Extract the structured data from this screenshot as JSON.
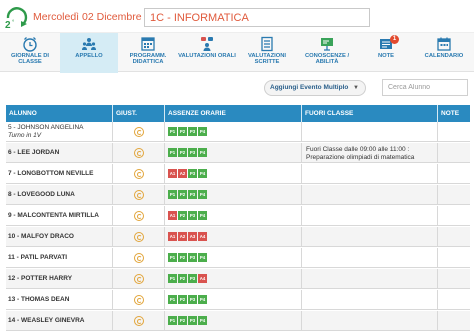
{
  "header": {
    "date": "Mercoledì 02 Dicembre",
    "class": "1C - INFORMATICA"
  },
  "colors": {
    "accent": "#e05a3c",
    "primary": "#2a7ab0",
    "table_header": "#2a8ac0",
    "present": "#4cae4c",
    "absent": "#d9534f",
    "giust": "#e2a53a"
  },
  "toolbar": [
    {
      "label": "GIORNALE DI CLASSE",
      "icon": "clock-icon",
      "active": false
    },
    {
      "label": "APPELLO",
      "icon": "people-icon",
      "active": true
    },
    {
      "label": "PROGRAMM. DIDATTICA",
      "icon": "calendar-grid-icon",
      "active": false
    },
    {
      "label": "VALUTAZIONI ORALI",
      "icon": "group-chat-icon",
      "active": false
    },
    {
      "label": "VALUTAZIONI SCRITTE",
      "icon": "checklist-icon",
      "active": false
    },
    {
      "label": "CONOSCENZE / ABILITÀ",
      "icon": "board-icon",
      "active": false
    },
    {
      "label": "NOTE",
      "icon": "notes-icon",
      "active": false,
      "badge": "1"
    },
    {
      "label": "CALENDARIO",
      "icon": "calendar-icon",
      "active": false
    }
  ],
  "actions": {
    "add_event": "Aggiungi Evento Multiplo",
    "search_placeholder": "Cerca Alunno"
  },
  "table": {
    "columns": [
      "ALUNNO",
      "GIUST.",
      "ASSENZE ORARIE",
      "FUORI CLASSE",
      "NOTE"
    ],
    "rows": [
      {
        "name": "5 - JOHNSON ANGELINA",
        "sub": "Turno in 1V",
        "hours": [
          "P1",
          "P2",
          "P3",
          "P4"
        ],
        "status": [
          "p",
          "p",
          "p",
          "p"
        ],
        "fuori": "",
        "absent": true
      },
      {
        "name": "6 - LEE JORDAN",
        "sub": "",
        "hours": [
          "P1",
          "P2",
          "P3",
          "P4"
        ],
        "status": [
          "p",
          "p",
          "p",
          "p"
        ],
        "fuori": "Fuori Classe dalle 09:00 alle 11:00 : Preparazione olimpiadi di matematica",
        "absent": false
      },
      {
        "name": "7 - LONGBOTTOM NEVILLE",
        "sub": "",
        "hours": [
          "A1",
          "A2",
          "P3",
          "P4"
        ],
        "status": [
          "a",
          "a",
          "p",
          "p"
        ],
        "fuori": "",
        "absent": false
      },
      {
        "name": "8 - LOVEGOOD LUNA",
        "sub": "",
        "hours": [
          "P1",
          "P2",
          "P3",
          "P4"
        ],
        "status": [
          "p",
          "p",
          "p",
          "p"
        ],
        "fuori": "",
        "absent": false
      },
      {
        "name": "9 - MALCONTENTA MIRTILLA",
        "sub": "",
        "hours": [
          "A1",
          "P2",
          "P3",
          "P4"
        ],
        "status": [
          "a",
          "p",
          "p",
          "p"
        ],
        "fuori": "",
        "absent": false
      },
      {
        "name": "10 - MALFOY DRACO",
        "sub": "",
        "hours": [
          "A1",
          "A2",
          "A3",
          "A4"
        ],
        "status": [
          "a",
          "a",
          "a",
          "a"
        ],
        "fuori": "",
        "absent": false
      },
      {
        "name": "11 - PATIL PARVATI",
        "sub": "",
        "hours": [
          "P1",
          "P2",
          "P3",
          "P4"
        ],
        "status": [
          "p",
          "p",
          "p",
          "p"
        ],
        "fuori": "",
        "absent": false
      },
      {
        "name": "12 - POTTER HARRY",
        "sub": "",
        "hours": [
          "P1",
          "P2",
          "P3",
          "A4"
        ],
        "status": [
          "p",
          "p",
          "p",
          "a"
        ],
        "fuori": "",
        "absent": false
      },
      {
        "name": "13 - THOMAS DEAN",
        "sub": "",
        "hours": [
          "P1",
          "P2",
          "P3",
          "P4"
        ],
        "status": [
          "p",
          "p",
          "p",
          "p"
        ],
        "fuori": "",
        "absent": false
      },
      {
        "name": "14 - WEASLEY GINEVRA",
        "sub": "",
        "hours": [
          "P1",
          "P2",
          "P3",
          "P4"
        ],
        "status": [
          "p",
          "p",
          "p",
          "p"
        ],
        "fuori": "",
        "absent": false
      }
    ]
  }
}
